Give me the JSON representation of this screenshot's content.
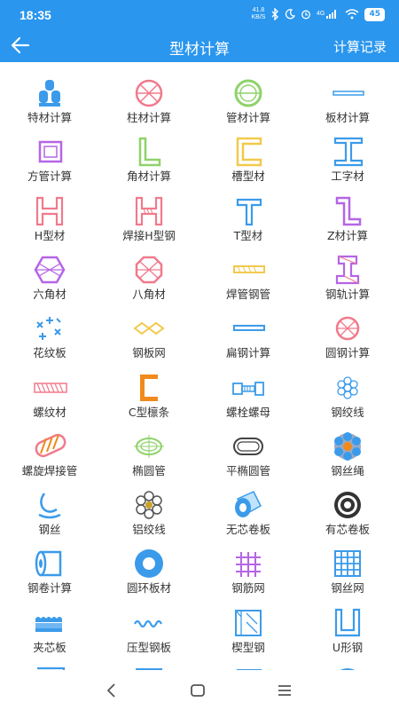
{
  "status": {
    "time": "18:35",
    "net_speed_value": "41.8",
    "net_speed_unit": "KB/S",
    "network": "4G",
    "battery": "45"
  },
  "header": {
    "title": "型材计算",
    "record": "计算记录"
  },
  "items": [
    {
      "label": "特材计算",
      "icon": "bars-stack-icon"
    },
    {
      "label": "柱材计算",
      "icon": "round-column-icon"
    },
    {
      "label": "管材计算",
      "icon": "pipe-icon"
    },
    {
      "label": "板材计算",
      "icon": "plate-icon"
    },
    {
      "label": "方管计算",
      "icon": "square-tube-icon"
    },
    {
      "label": "角材计算",
      "icon": "angle-icon"
    },
    {
      "label": "槽型材",
      "icon": "channel-icon"
    },
    {
      "label": "工字材",
      "icon": "i-beam-icon"
    },
    {
      "label": "H型材",
      "icon": "h-beam-icon"
    },
    {
      "label": "焊接H型钢",
      "icon": "welded-h-beam-icon"
    },
    {
      "label": "T型材",
      "icon": "t-bar-icon"
    },
    {
      "label": "Z材计算",
      "icon": "z-bar-icon"
    },
    {
      "label": "六角材",
      "icon": "hexagon-bar-icon"
    },
    {
      "label": "八角材",
      "icon": "octagon-bar-icon"
    },
    {
      "label": "焊管钢管",
      "icon": "welded-pipe-icon"
    },
    {
      "label": "钢轨计算",
      "icon": "rail-icon"
    },
    {
      "label": "花纹板",
      "icon": "checker-plate-icon"
    },
    {
      "label": "钢板网",
      "icon": "expanded-mesh-icon"
    },
    {
      "label": "扁钢计算",
      "icon": "flat-bar-icon"
    },
    {
      "label": "圆钢计算",
      "icon": "round-bar-icon"
    },
    {
      "label": "螺纹材",
      "icon": "rebar-icon"
    },
    {
      "label": "C型檩条",
      "icon": "c-purlin-icon"
    },
    {
      "label": "螺栓螺母",
      "icon": "bolt-nut-icon"
    },
    {
      "label": "钢绞线",
      "icon": "strand-icon"
    },
    {
      "label": "螺旋焊接管",
      "icon": "spiral-pipe-icon"
    },
    {
      "label": "椭圆管",
      "icon": "oval-pipe-icon"
    },
    {
      "label": "平椭圆管",
      "icon": "flat-oval-pipe-icon"
    },
    {
      "label": "钢丝绳",
      "icon": "wire-rope-icon"
    },
    {
      "label": "钢丝",
      "icon": "wire-icon"
    },
    {
      "label": "铝绞线",
      "icon": "aluminum-strand-icon"
    },
    {
      "label": "无芯卷板",
      "icon": "coreless-coil-icon"
    },
    {
      "label": "有芯卷板",
      "icon": "cored-coil-icon"
    },
    {
      "label": "钢卷计算",
      "icon": "steel-coil-icon"
    },
    {
      "label": "圆环板材",
      "icon": "ring-plate-icon"
    },
    {
      "label": "钢筋网",
      "icon": "rebar-mesh-icon"
    },
    {
      "label": "钢丝网",
      "icon": "wire-mesh-icon"
    },
    {
      "label": "夹芯板",
      "icon": "sandwich-panel-icon"
    },
    {
      "label": "压型钢板",
      "icon": "corrugated-plate-icon"
    },
    {
      "label": "楔型钢",
      "icon": "wedge-steel-icon"
    },
    {
      "label": "U形钢",
      "icon": "u-steel-icon"
    }
  ],
  "colors": {
    "primary": "#2a96ee",
    "pink": "#f07a8c",
    "green": "#8fd26a",
    "yellow": "#f2c94c",
    "blue": "#3b9bea",
    "purple": "#b565e6",
    "orange": "#f08a1c",
    "label": "#333333"
  }
}
